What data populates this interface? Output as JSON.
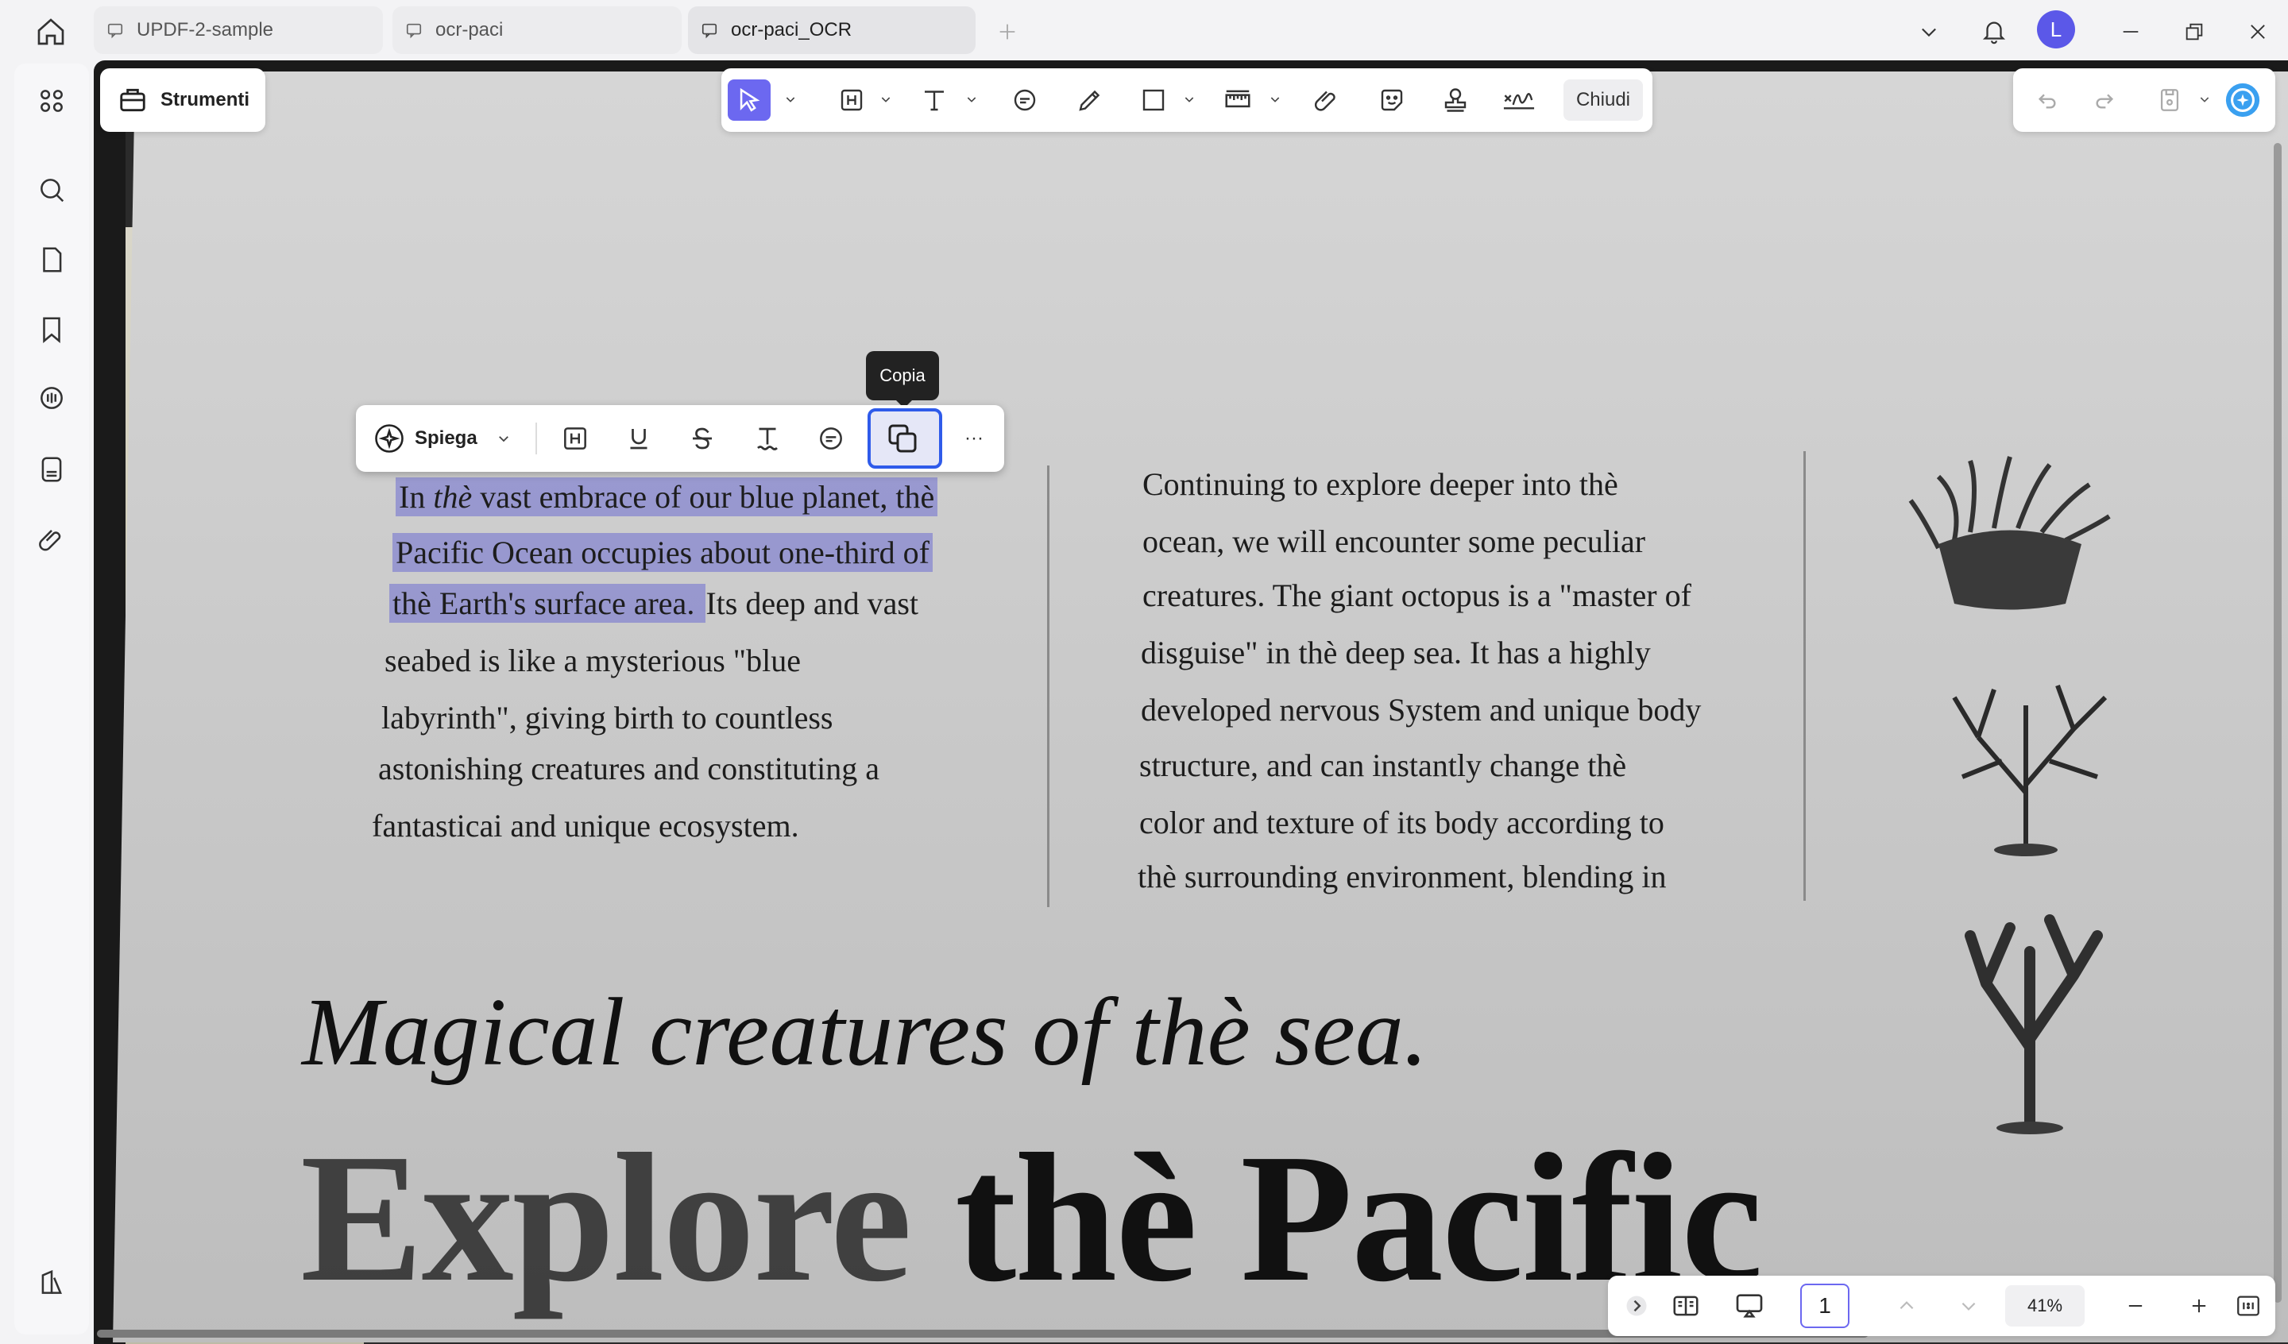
{
  "tabs": [
    {
      "label": "UPDF-2-sample"
    },
    {
      "label": "ocr-paci"
    },
    {
      "label": "ocr-paci_OCR"
    }
  ],
  "user": {
    "avatar_letter": "L"
  },
  "strumenti": {
    "label": "Strumenti"
  },
  "toolbar": {
    "close_label": "Chiudi"
  },
  "selection_toolbar": {
    "explain_label": "Spiega",
    "more_label": "···",
    "tooltip": "Copia"
  },
  "document": {
    "col1": {
      "line1_a": "In ",
      "line1_b": "thè",
      "line1_c": " vast embrace of our blue planet, thè",
      "line2": "Pacific Ocean occupies about one-third of",
      "line3_hl": "thè Earth's surface area. ",
      "line3_rest": "Its deep and vast",
      "line4": "seabed is like a mysterious \"blue",
      "line5": "labyrinth\", giving birth to countless",
      "line6": "astonishing creatures and constituting a",
      "line7": "fantasticai and unique ecosystem."
    },
    "col2": [
      "Continuing to explore deeper into thè",
      "ocean, we will encounter some peculiar",
      "creatures. The giant octopus is a \"master of",
      "disguise\" in thè deep sea. It has a highly",
      "developed nervous System and unique body",
      "structure, and can instantly change thè",
      "color and texture of its body according to",
      "thè surrounding environment, blending in"
    ],
    "heading_italic": "Magical creatures of thè sea.",
    "heading_big_a": "Explore ",
    "heading_big_b": "thè Pacific"
  },
  "pager": {
    "page": "1",
    "zoom": "41%"
  },
  "colors": {
    "accent": "#6c68f0",
    "selection": "#6e6ed2",
    "copy_highlight": "#2f5bea"
  }
}
